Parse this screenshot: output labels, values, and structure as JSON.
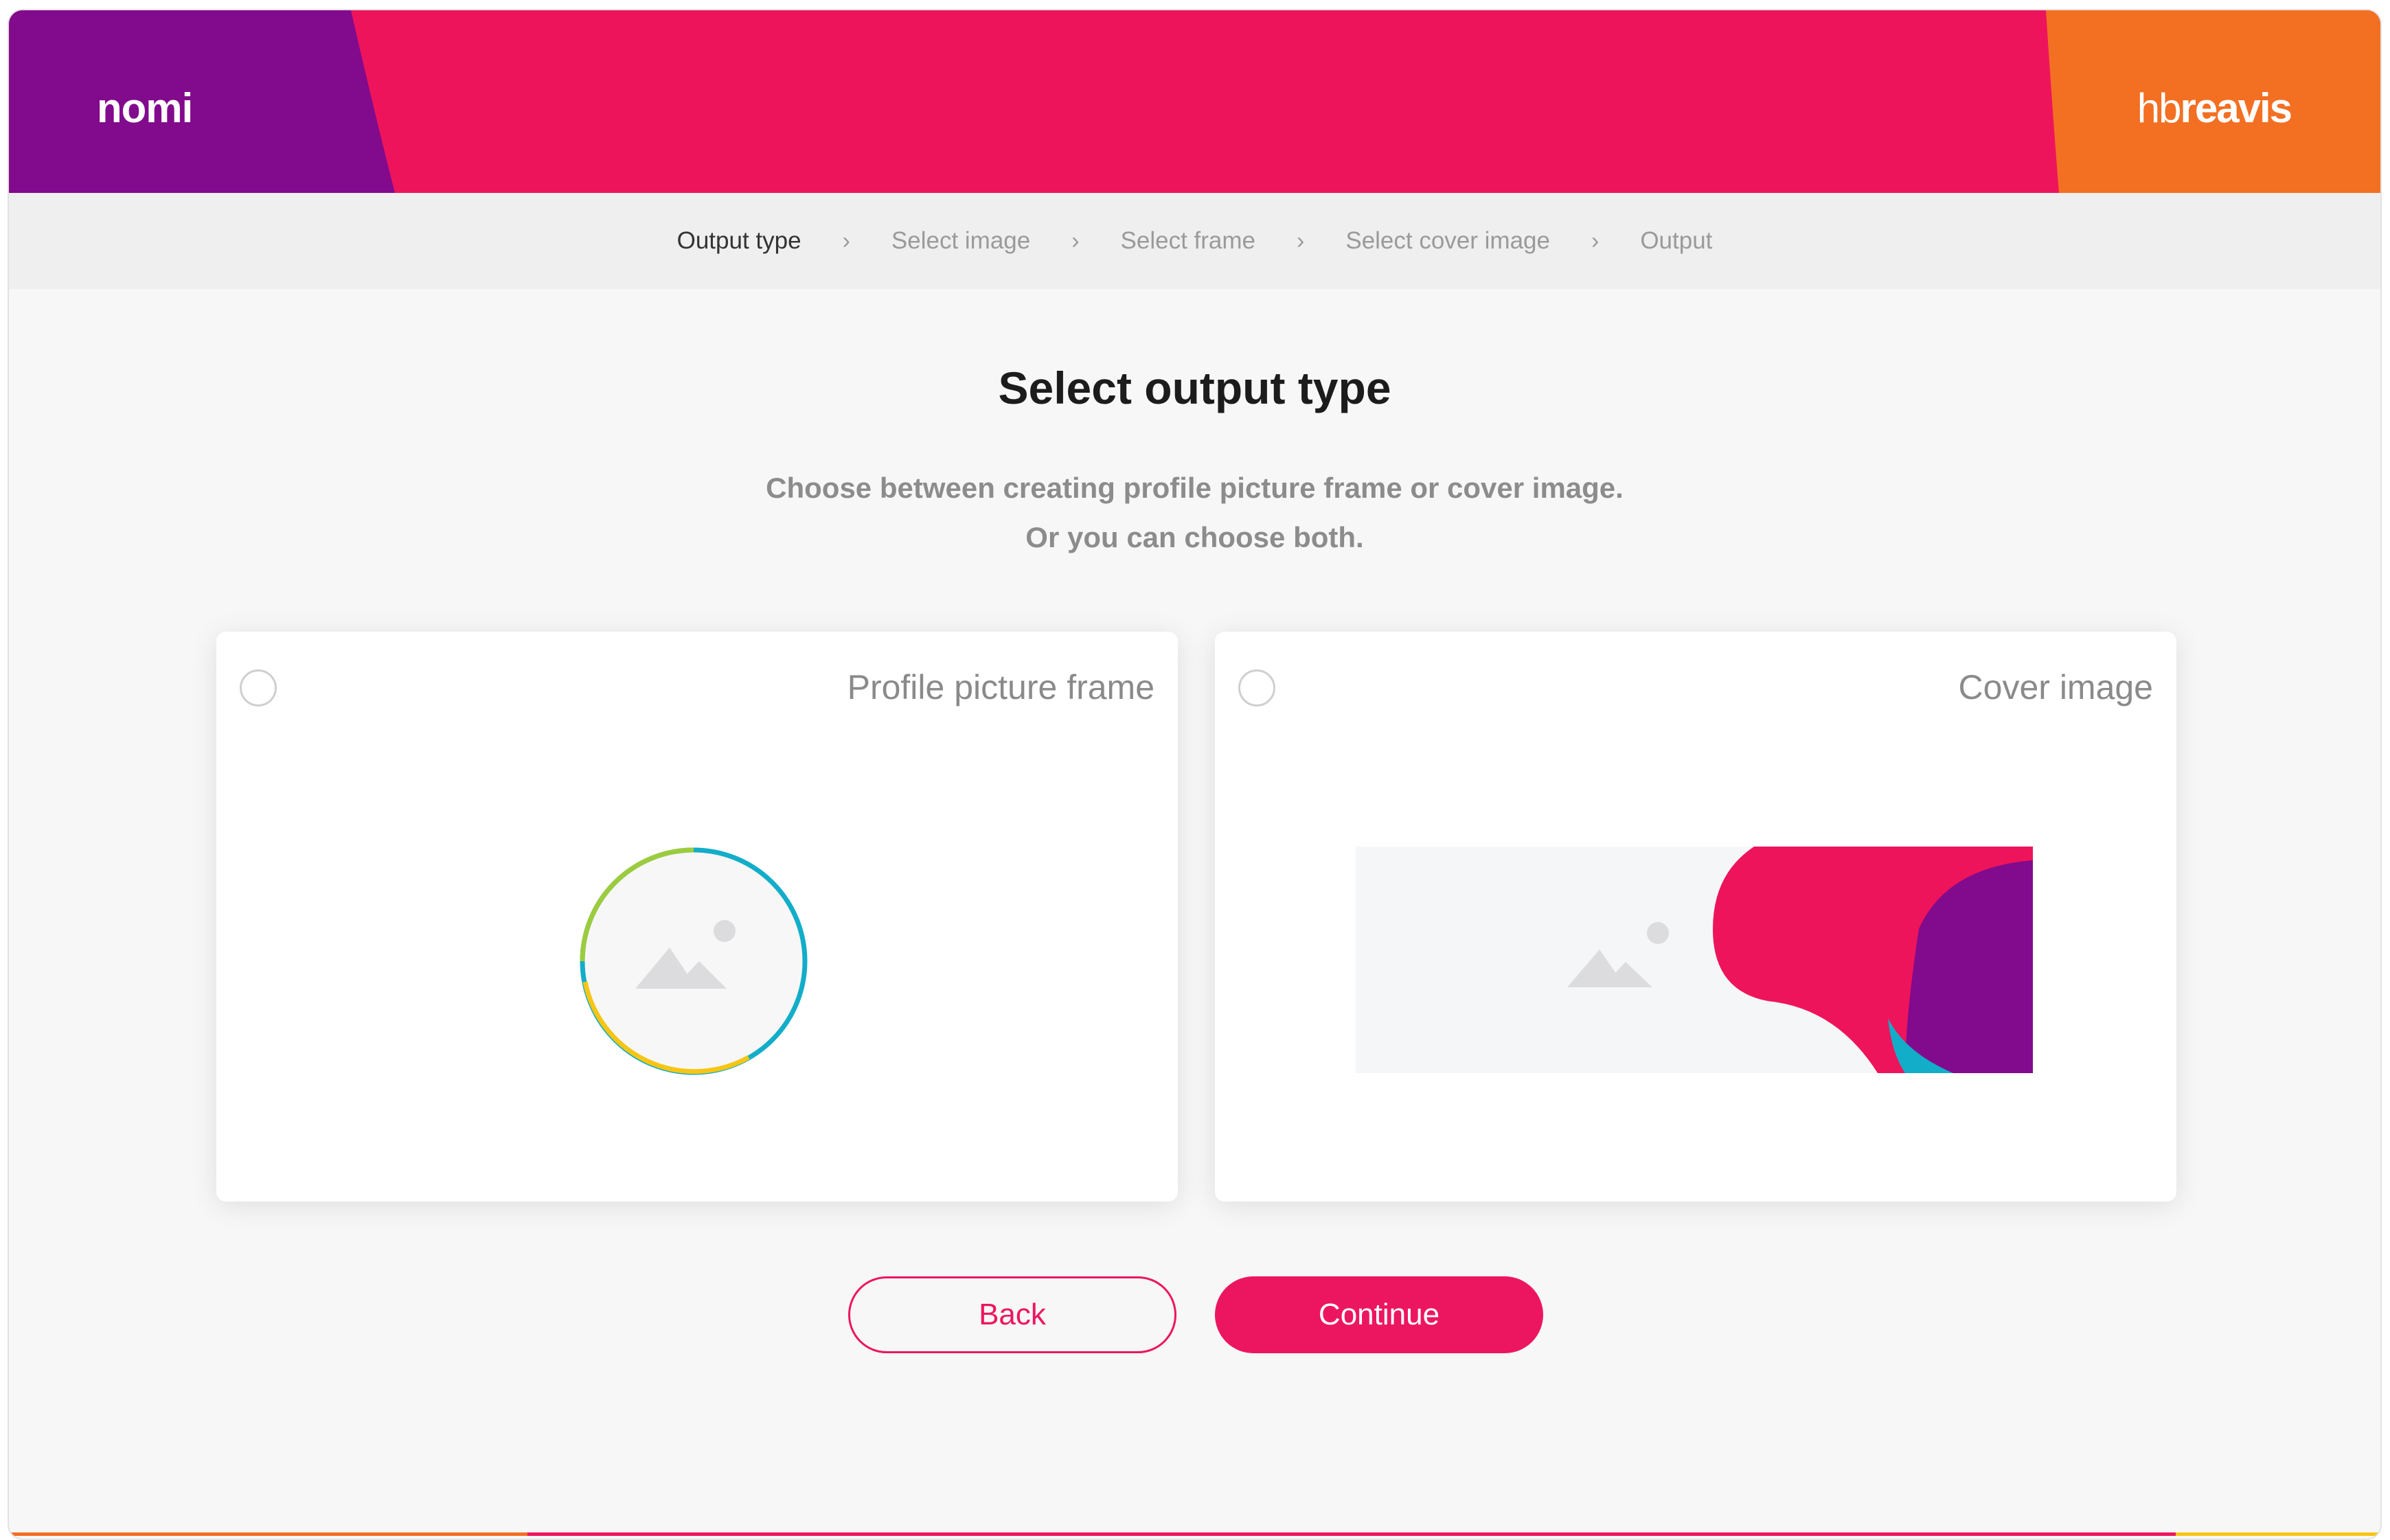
{
  "header": {
    "brand_left": "nomi",
    "brand_right_light": "hb",
    "brand_right_bold": "reavis",
    "colors": {
      "purple": "#820a8c",
      "pink": "#ee145c",
      "orange": "#f36f22"
    }
  },
  "breadcrumb": {
    "items": [
      {
        "label": "Output type",
        "active": true
      },
      {
        "label": "Select image",
        "active": false
      },
      {
        "label": "Select frame",
        "active": false
      },
      {
        "label": "Select cover image",
        "active": false
      },
      {
        "label": "Output",
        "active": false
      }
    ],
    "separator_icon": "chevron-right-icon"
  },
  "main": {
    "title": "Select output type",
    "subtitle_line1": "Choose between creating profile picture frame or cover image.",
    "subtitle_line2": "Or you can choose both."
  },
  "options": [
    {
      "label": "Profile picture frame",
      "selected": false,
      "icon": "image-placeholder-icon"
    },
    {
      "label": "Cover image",
      "selected": false,
      "icon": "image-placeholder-icon"
    }
  ],
  "actions": {
    "back_label": "Back",
    "continue_label": "Continue"
  },
  "accent_color": "#ec1660"
}
